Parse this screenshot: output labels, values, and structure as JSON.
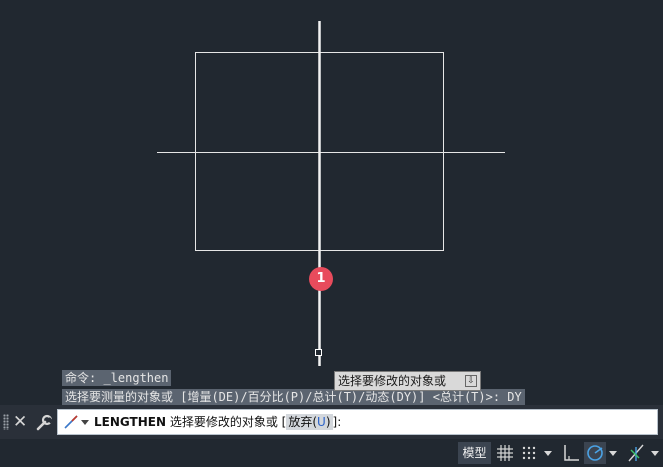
{
  "history": {
    "line1": "命令: _lengthen",
    "line2": "选择要测量的对象或 [增量(DE)/百分比(P)/总计(T)/动态(DY)] <总计(T)>: DY"
  },
  "tooltip": {
    "text": "选择要修改的对象或"
  },
  "annotation": {
    "badge": "1"
  },
  "command_line": {
    "command": "LENGTHEN",
    "prompt": "选择要修改的对象或",
    "bracket_open": "[",
    "option_label": "放弃(",
    "option_key": "U",
    "option_close": ")",
    "bracket_close": "]:"
  },
  "status_bar": {
    "model_tab": "模型"
  },
  "colors": {
    "canvas_bg": "#212830",
    "geometry": "#e6e6e6",
    "badge": "#e84b5c",
    "command_bg": "#ffffff",
    "hotkey": "#2a62c9"
  },
  "icons": {
    "close": "close-icon",
    "customize": "wrench-icon",
    "command": "lengthen-command-icon",
    "grid": "grid-icon",
    "snap": "snap-icon",
    "ortho": "ortho-icon",
    "polar": "polar-tracking-icon",
    "osnap": "object-snap-icon"
  }
}
